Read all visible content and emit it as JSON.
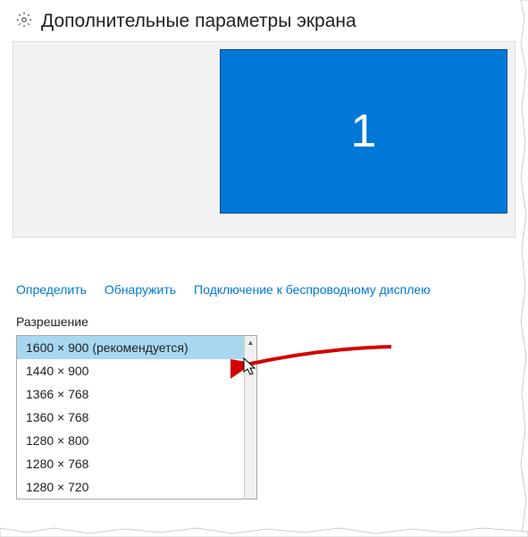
{
  "header": {
    "title": "Дополнительные параметры экрана"
  },
  "monitor": {
    "number": "1"
  },
  "links": {
    "identify": "Определить",
    "detect": "Обнаружить",
    "wireless": "Подключение к беспроводному дисплею"
  },
  "resolution": {
    "label": "Разрешение",
    "options": [
      "1600 × 900 (рекомендуется)",
      "1440 × 900",
      "1366 × 768",
      "1360 × 768",
      "1280 × 800",
      "1280 × 768",
      "1280 × 720"
    ],
    "selected_index": 0
  }
}
